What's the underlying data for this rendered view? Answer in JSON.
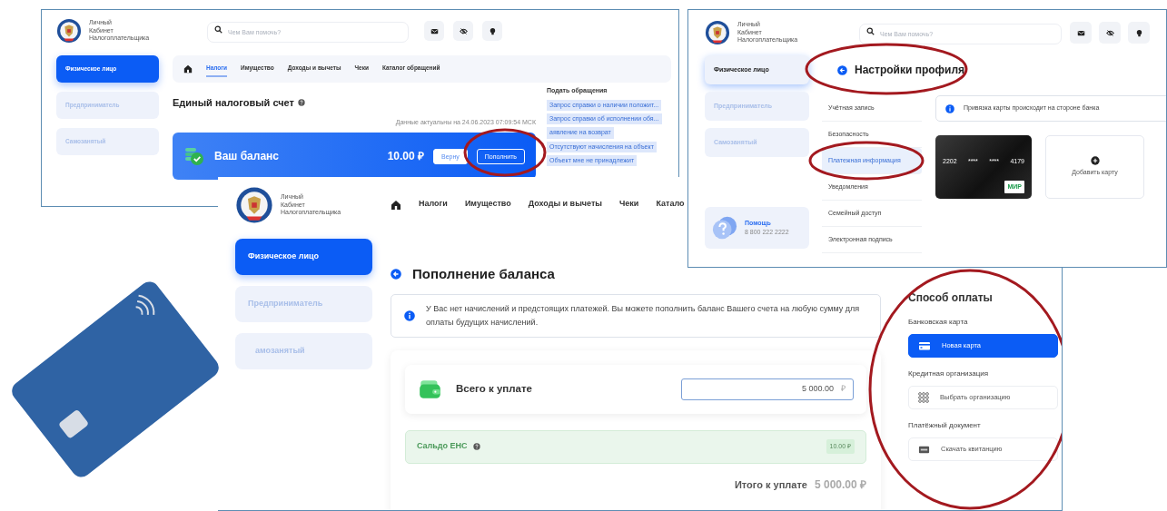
{
  "tax_account_screen": {
    "logo_lines": [
      "Личный",
      "Кабинет",
      "Налогоплательщика"
    ],
    "search": {
      "placeholder": "Чем Вам помочь?"
    },
    "sidebar": [
      {
        "label": "Физическое лицо",
        "selected": true
      },
      {
        "label": "Предприниматель",
        "selected": false
      },
      {
        "label": "Самозанятый",
        "selected": false
      }
    ],
    "nav": [
      {
        "label": "Налоги",
        "selected": true
      },
      {
        "label": "Имущество",
        "selected": false
      },
      {
        "label": "Доходы и вычеты",
        "selected": false
      },
      {
        "label": "Чеки",
        "selected": false
      },
      {
        "label": "Каталог обращений",
        "selected": false
      }
    ],
    "title": "Единый налоговый счет",
    "updated": "Данные актуальны на 24.06.2023 07:09:54 МСК",
    "balance": {
      "label": "Ваш баланс",
      "amount": "10.00 ₽",
      "buttons": [
        {
          "label": "Верну",
          "kind": "light"
        },
        {
          "label": "Пополнить",
          "kind": "outline"
        }
      ]
    },
    "requests": {
      "title": "Подать обращения",
      "items": [
        "Запрос справки о наличии положит...",
        "Запрос справки об исполнении обя...",
        "аявление на возврат",
        "Отсутствуют начисления на объект",
        "Объект мне не принадлежит"
      ]
    }
  },
  "payment_screen": {
    "logo_lines": [
      "Личный",
      "Кабинет",
      "Налогоплательщика"
    ],
    "nav": [
      {
        "label": "Налоги",
        "selected": false
      },
      {
        "label": "Имущество",
        "selected": false
      },
      {
        "label": "Доходы и вычеты",
        "selected": false
      },
      {
        "label": "Чеки",
        "selected": false
      },
      {
        "label": "Катало",
        "selected": false
      }
    ],
    "sidebar": [
      {
        "label": "Физическое лицо",
        "selected": true
      },
      {
        "label": "Предприниматель",
        "selected": false
      },
      {
        "label": "амозанятый",
        "selected": false
      }
    ],
    "title": "Пополнение баланса",
    "info": "У Вас нет начислений и предстоящих платежей. Вы можете пополнить баланс Вашего счета на любую сумму для оплаты будущих начислений.",
    "total": {
      "label": "Всего к уплате",
      "value": "5 000.00",
      "currency": "₽"
    },
    "saldo": {
      "label": "Сальдо ЕНС",
      "value": "10.00 ₽"
    },
    "final": {
      "label": "Итого к уплате",
      "value": "**5 000**.00 ₽"
    },
    "payment_methods": {
      "title": "Способ оплаты",
      "groups": [
        {
          "heading": "Банковская карта",
          "option": "Новая карта",
          "kind": "card",
          "selected": true
        },
        {
          "heading": "Кредитная организация",
          "option": "Выбрать организацию",
          "kind": "bank",
          "selected": false
        },
        {
          "heading": "Платёжный документ",
          "option": "Скачать квитанцию",
          "kind": "document",
          "selected": false
        }
      ]
    }
  },
  "profile_screen": {
    "logo_lines": [
      "Личный",
      "Кабинет",
      "Налогоплательщика"
    ],
    "search": {
      "placeholder": "Чем Вам помочь?"
    },
    "sidebar": [
      {
        "label": "Физическое лицо",
        "selected": true
      },
      {
        "label": "Предприниматель",
        "selected": false
      },
      {
        "label": "Самозанятый",
        "selected": false
      }
    ],
    "help": {
      "title": "Помощь",
      "phone": "8 800 222 2222"
    },
    "title": "Настройки профиля",
    "menu": [
      {
        "label": "Учётная запись",
        "selected": false
      },
      {
        "label": "Безопасность",
        "selected": false
      },
      {
        "label": "Платежная информация",
        "selected": true
      },
      {
        "label": "Уведомления",
        "selected": false
      },
      {
        "label": "Семейный доступ",
        "selected": false
      },
      {
        "label": "Электронная подпись",
        "selected": false
      }
    ],
    "info": "Привязка карты происходит на стороне банка",
    "card": {
      "number_parts": [
        "2202",
        "****",
        "****",
        "4179"
      ],
      "brand": "МИР"
    },
    "add_card": "Добавить карту"
  }
}
